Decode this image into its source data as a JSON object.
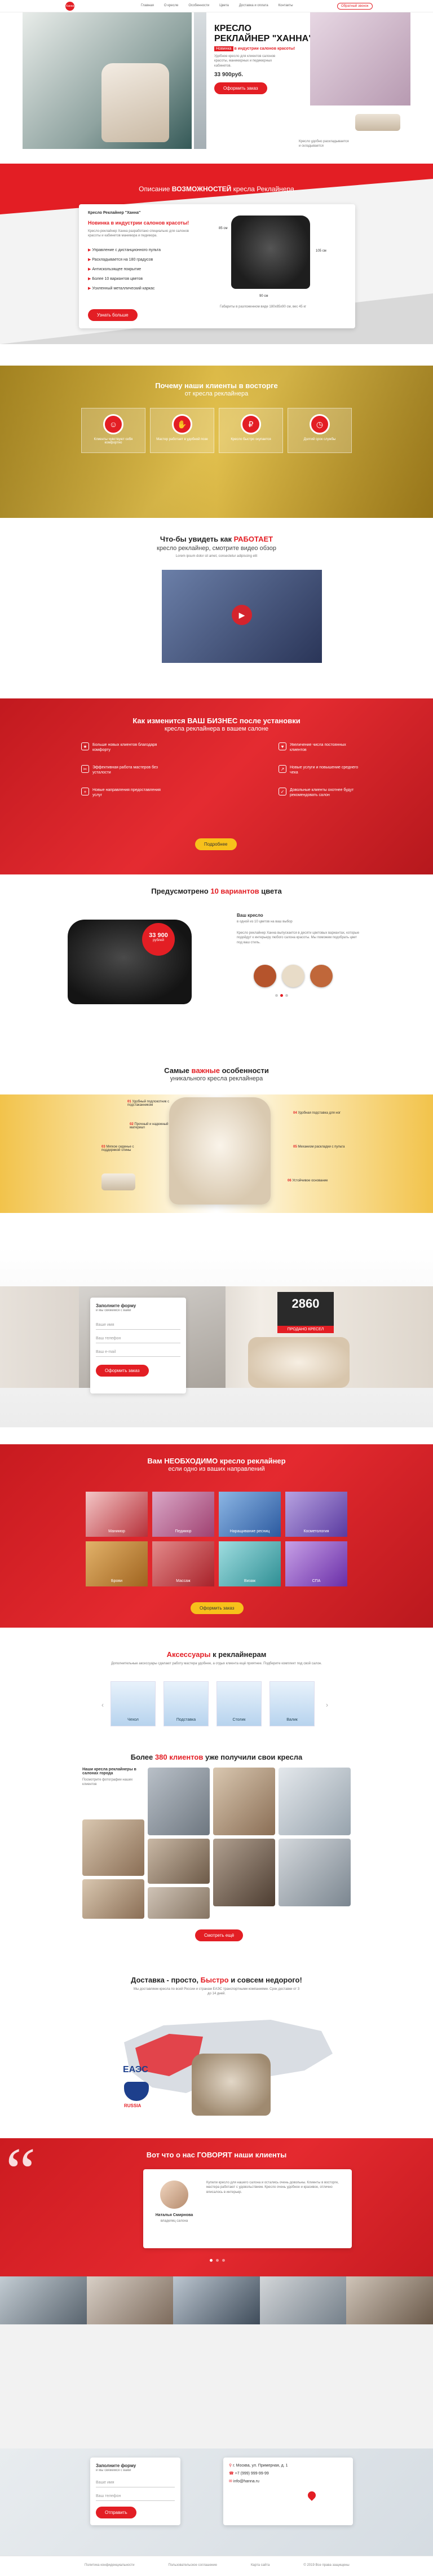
{
  "header": {
    "logo_text": "Ханна",
    "nav": [
      "Главная",
      "О кресле",
      "Особенности",
      "Цвета",
      "Доставка и оплата",
      "Контакты"
    ],
    "callback_label": "Обратный звонок"
  },
  "hero": {
    "title_line1": "КРЕСЛО",
    "title_line2": "РЕКЛАЙНЕР \"ХАННА\"",
    "badge": "Новинка",
    "badge_text": "в индустрии салонов красоты!",
    "desc": "Удобное кресло для клиентов салонов красоты, маникюрных и педикюрных кабинетов.",
    "price": "33 900руб.",
    "order_label": "Оформить заказ",
    "caption": "Кресло удобно раскладывается и складывается"
  },
  "description": {
    "title_prefix": "Описание",
    "title_accent": "ВОЗМОЖНОСТЕЙ",
    "title_suffix": "кресла Реклайнера",
    "product_name": "Кресло Реклайнер \"Ханна\"",
    "tagline": "Новинка в индустрии салонов красоты!",
    "intro": "Кресло-реклайнер Ханна разработано специально для салонов красоты и кабинетов маникюра и педикюра.",
    "features": [
      "Управление с дистанционного пульта",
      "Раскладывается на 180 градусов",
      "Антискользящее покрытие",
      "Более 10 вариантов цветов",
      "Усиленный металлический каркас"
    ],
    "more_label": "Узнать больше",
    "dim_width": "90 см",
    "dim_height": "105 см",
    "dim_depth": "85 см",
    "spec_note": "Габариты в разложенном виде 180х85х90 см, вес 45 кг"
  },
  "why": {
    "title": "Почему наши клиенты в восторге",
    "subtitle": "от кресла реклайнера",
    "items": [
      "Клиенты чувствуют себя комфортно",
      "Мастер работает в удобной позе",
      "Кресло быстро окупается",
      "Долгий срок службы"
    ]
  },
  "video": {
    "title_prefix": "Что-бы увидеть как",
    "title_accent": "РАБОТАЕТ",
    "subtitle": "кресло реклайнер, смотрите видео обзор",
    "note": "Lorem ipsum dolor sit amet, consectetur adipiscing elit"
  },
  "business": {
    "title": "Как изменится ВАШ БИЗНЕС после установки",
    "subtitle": "кресла реклайнера в вашем салоне",
    "benefits": [
      "Больше новых клиентов благодаря комфорту",
      "Увеличение числа постоянных клиентов",
      "Эффективная работа мастеров без усталости",
      "Новые услуги и повышение среднего чека",
      "Новые направления предоставления услуг",
      "Довольные клиенты охотнее будут рекомендовать салон"
    ],
    "cta_label": "Подробнее"
  },
  "colors": {
    "title_prefix": "Предусмотрено",
    "title_accent": "10 вариантов",
    "title_suffix": "цвета",
    "price_badge": "33 900",
    "price_unit": "рублей",
    "heading": "Ваш кресло",
    "subheading": "в одной из 10 цветов на ваш выбор",
    "desc": "Кресло реклайнер Ханна выпускается в десяти цветовых вариантах, которые подойдут к интерьеру любого салона красоты. Мы поможем подобрать цвет под ваш стиль.",
    "swatches": [
      "#b5542c",
      "#e8dcc8",
      "#c0673a"
    ],
    "active_dot": 1
  },
  "features": {
    "title_prefix": "Самые",
    "title_accent": "важные",
    "title_suffix": "особенности",
    "subtitle": "уникального кресла реклайнера",
    "points": [
      {
        "num": "01",
        "text": "Удобный подлокотник с подстаканником"
      },
      {
        "num": "02",
        "text": "Прочный и надежный материал"
      },
      {
        "num": "03",
        "text": "Мягкое сиденье с поддержкой спины"
      },
      {
        "num": "04",
        "text": "Удобная подставка для ног"
      },
      {
        "num": "05",
        "text": "Механизм раскладки с пульта"
      },
      {
        "num": "06",
        "text": "Устойчивое основание"
      }
    ]
  },
  "stats": {
    "form_title": "Заполните форму",
    "form_sub": "и мы свяжемся с вами",
    "fields": [
      "Ваше имя",
      "Ваш телефон",
      "Ваш e-mail"
    ],
    "submit_label": "Оформить заказ",
    "count": "2860",
    "count_label": "ПРОДАНО КРЕСЕЛ"
  },
  "directions": {
    "title_prefix": "Вам",
    "title_accent": "НЕОБХОДИМО",
    "title_suffix": "кресло реклайнер",
    "subtitle": "если одно из ваших направлений",
    "tiles": [
      "Маникюр",
      "Педикюр",
      "Наращивание ресниц",
      "Косметология",
      "Брови",
      "Массаж",
      "Визаж",
      "СПА"
    ],
    "cta_label": "Оформить заказ"
  },
  "accessories": {
    "title_accent": "Аксессуары",
    "title_suffix": "к реклайнерам",
    "desc": "Дополнительные аксессуары сделают работу мастера удобнее, а отдых клиента ещё приятнее. Подберите комплект под свой салон.",
    "products": [
      "Чехол",
      "Подставка",
      "Столик",
      "Валик"
    ]
  },
  "clients": {
    "title_prefix": "Более",
    "title_accent": "380 клиентов",
    "title_suffix": "уже получили свои кресла",
    "gallery_title": "Наши кресла реклайнеры в салонах города",
    "gallery_note": "Посмотрите фотографии наших клиентов",
    "more_label": "Смотреть ещё"
  },
  "delivery": {
    "title_prefix": "Доставка - просто,",
    "title_accent": "Быстро",
    "title_suffix": "и совсем недорого!",
    "desc": "Мы доставляем кресла по всей России и странам ЕАЭС транспортными компаниями. Срок доставки от 3 до 14 дней.",
    "eaeu": "ЕАЭС",
    "russia": "RUSSIA"
  },
  "reviews": {
    "title_prefix": "Вот что о нас",
    "title_accent": "ГОВОРЯТ",
    "title_suffix": "наши клиенты",
    "author_name": "Наталья Смирнова",
    "author_role": "владелец салона",
    "text": "Купили кресло для нашего салона и остались очень довольны. Клиенты в восторге, мастера работают с удовольствием. Кресло очень удобное и красивое, отлично вписалось в интерьер.",
    "quote_mark": "“",
    "dots": 3
  },
  "contact": {
    "form_title": "Заполните форму",
    "form_sub": "и мы свяжемся с вами",
    "fields": [
      "Ваше имя",
      "Ваш телефон"
    ],
    "submit_label": "Отправить",
    "address": "г. Москва, ул. Примерная, д. 1",
    "phone": "+7 (999) 999-99-99",
    "email": "info@hanna.ru"
  },
  "footer": {
    "links": [
      "Политика конфиденциальности",
      "Пользовательское соглашение",
      "Карта сайта",
      "© 2019 Все права защищены"
    ]
  }
}
